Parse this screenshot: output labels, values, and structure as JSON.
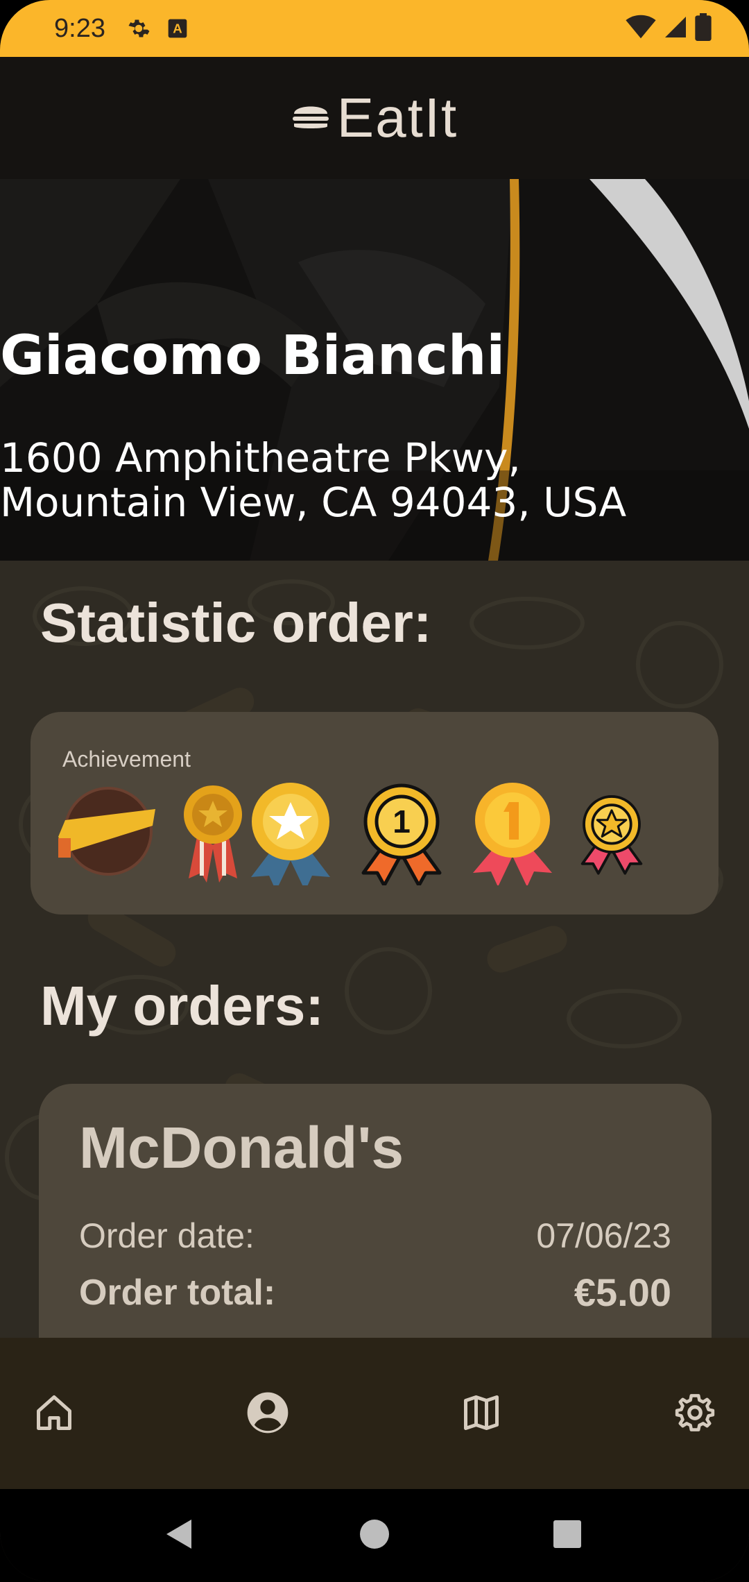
{
  "status_bar": {
    "time": "9:23",
    "icons": [
      "gear-icon",
      "text-a-icon",
      "wifi-icon",
      "signal-icon",
      "battery-icon"
    ]
  },
  "app_bar": {
    "title": "EatIt",
    "logo_icon": "burger-icon"
  },
  "profile": {
    "name": "Giacomo Bianchi",
    "address_line1": "1600 Amphitheatre Pkwy,",
    "address_line2": "Mountain View, CA 94043, USA"
  },
  "statistic": {
    "title": "Statistic order:",
    "card_label": "Achievement",
    "medals": [
      "ribbon-badge-icon",
      "gold-star-medal-icon",
      "star-medal-icon",
      "first-place-medal-icon",
      "gold-first-medal-icon",
      "star-medal-pink-icon"
    ]
  },
  "orders": {
    "title": "My orders:",
    "items": [
      {
        "restaurant": "McDonald's",
        "date_label": "Order date:",
        "date_value": "07/06/23",
        "total_label": "Order total:",
        "total_value": "€5.00"
      }
    ]
  },
  "bottom_nav": {
    "items": [
      "home-icon",
      "account-icon",
      "map-icon",
      "settings-icon"
    ],
    "selected": "account-icon"
  },
  "system_nav": {
    "buttons": [
      "back-icon",
      "home-circle-icon",
      "recents-icon"
    ]
  },
  "colors": {
    "status_bar": "#fbb62a",
    "app_bar": "#151311",
    "card": "#4e473b",
    "text_light": "#ece3da"
  }
}
